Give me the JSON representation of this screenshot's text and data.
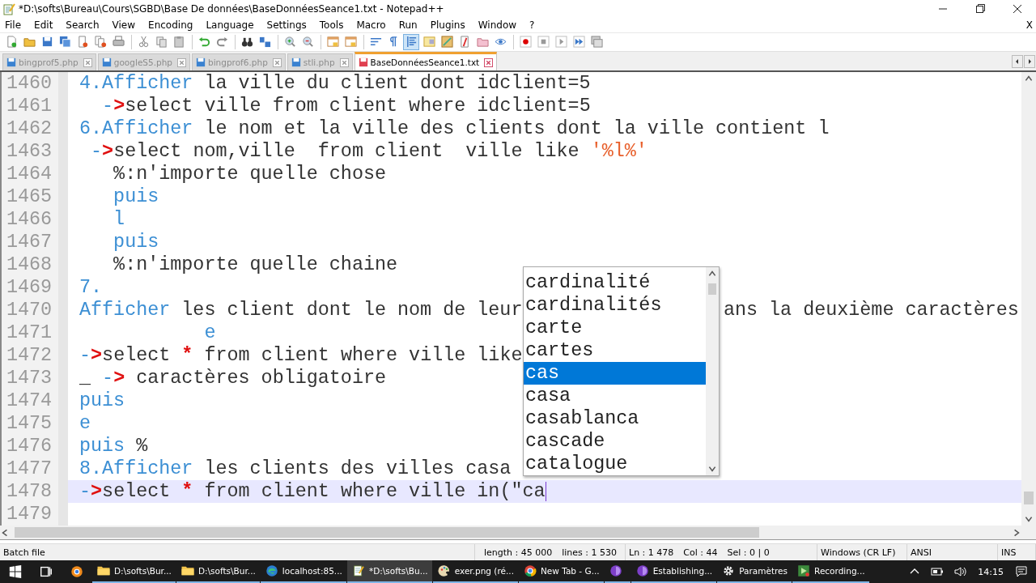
{
  "window": {
    "title": "*D:\\softs\\Bureau\\Cours\\SGBD\\Base De données\\BaseDonnéesSeance1.txt - Notepad++"
  },
  "menu": [
    "File",
    "Edit",
    "Search",
    "View",
    "Encoding",
    "Language",
    "Settings",
    "Tools",
    "Macro",
    "Run",
    "Plugins",
    "Window",
    "?"
  ],
  "close_document": "X",
  "toolbar": [
    {
      "kind": "new",
      "on": false
    },
    {
      "kind": "open",
      "on": false
    },
    {
      "kind": "save",
      "on": false
    },
    {
      "kind": "save-all",
      "on": false
    },
    {
      "kind": "close",
      "on": false
    },
    {
      "kind": "close-all",
      "on": false
    },
    {
      "kind": "print",
      "on": false
    },
    {
      "kind": "sep"
    },
    {
      "kind": "cut",
      "on": false
    },
    {
      "kind": "copy",
      "on": false
    },
    {
      "kind": "paste",
      "on": false
    },
    {
      "kind": "sep"
    },
    {
      "kind": "undo",
      "on": false
    },
    {
      "kind": "redo",
      "on": false
    },
    {
      "kind": "sep"
    },
    {
      "kind": "find",
      "on": false
    },
    {
      "kind": "replace",
      "on": false
    },
    {
      "kind": "sep"
    },
    {
      "kind": "zoom-in",
      "on": false
    },
    {
      "kind": "zoom-out",
      "on": false
    },
    {
      "kind": "sep"
    },
    {
      "kind": "window",
      "on": false
    },
    {
      "kind": "window",
      "on": false
    },
    {
      "kind": "sep"
    },
    {
      "kind": "wrap",
      "on": false
    },
    {
      "kind": "pilcrow",
      "on": false
    },
    {
      "kind": "indent",
      "on": true
    },
    {
      "kind": "panel",
      "on": false
    },
    {
      "kind": "map",
      "on": false
    },
    {
      "kind": "function",
      "on": false
    },
    {
      "kind": "folder",
      "on": false
    },
    {
      "kind": "eye",
      "on": false
    },
    {
      "kind": "sep"
    },
    {
      "kind": "record",
      "on": false
    },
    {
      "kind": "stop",
      "on": false
    },
    {
      "kind": "play",
      "on": false
    },
    {
      "kind": "play-multi",
      "on": false
    },
    {
      "kind": "save-macro",
      "on": false
    }
  ],
  "tabs": [
    {
      "label": "bingprof5.php",
      "modified": false,
      "selected": false
    },
    {
      "label": "googleS5.php",
      "modified": false,
      "selected": false
    },
    {
      "label": "bingprof6.php",
      "modified": false,
      "selected": false
    },
    {
      "label": "stli.php",
      "modified": false,
      "selected": false
    },
    {
      "label": "BaseDonnéesSeance1.txt",
      "modified": true,
      "selected": true
    }
  ],
  "editor": {
    "lines": [
      {
        "number": "1460",
        "current": false,
        "segments": [
          {
            "kind": "keyword",
            "text": "4.Afficher"
          },
          {
            "kind": "plain",
            "text": " la ville du client dont idclient=5"
          }
        ]
      },
      {
        "number": "1461",
        "current": false,
        "segments": [
          {
            "kind": "keyword",
            "text": "  -"
          },
          {
            "kind": "operator",
            "text": ">"
          },
          {
            "kind": "plain",
            "text": "select ville from client where idclient=5"
          }
        ]
      },
      {
        "number": "1462",
        "current": false,
        "segments": [
          {
            "kind": "keyword",
            "text": "6.Afficher"
          },
          {
            "kind": "plain",
            "text": " le nom et la ville des clients dont la ville contient l"
          }
        ]
      },
      {
        "number": "1463",
        "current": false,
        "segments": [
          {
            "kind": "keyword",
            "text": " -"
          },
          {
            "kind": "operator",
            "text": ">"
          },
          {
            "kind": "plain",
            "text": "select nom,ville  from client  ville like "
          },
          {
            "kind": "string",
            "text": "'%l%'"
          }
        ]
      },
      {
        "number": "1464",
        "current": false,
        "segments": [
          {
            "kind": "plain",
            "text": "   %:n'importe quelle chose"
          }
        ]
      },
      {
        "number": "1465",
        "current": false,
        "segments": [
          {
            "kind": "keyword",
            "text": "   puis"
          }
        ]
      },
      {
        "number": "1466",
        "current": false,
        "segments": [
          {
            "kind": "keyword",
            "text": "   l"
          }
        ]
      },
      {
        "number": "1467",
        "current": false,
        "segments": [
          {
            "kind": "keyword",
            "text": "   puis"
          }
        ]
      },
      {
        "number": "1468",
        "current": false,
        "segments": [
          {
            "kind": "plain",
            "text": "   %:n'importe quelle chaine"
          }
        ]
      },
      {
        "number": "1469",
        "current": false,
        "segments": [
          {
            "kind": "keyword",
            "text": "7."
          }
        ]
      },
      {
        "number": "1470",
        "current": false,
        "segments": [
          {
            "kind": "keyword",
            "text": "Afficher"
          },
          {
            "kind": "plain",
            "text": " les client dont le nom de leur"
          },
          {
            "kind": "after-popup",
            "text": "ans la deuxième caractères"
          }
        ]
      },
      {
        "number": "1471",
        "current": false,
        "segments": [
          {
            "kind": "keyword",
            "text": "           e"
          }
        ]
      },
      {
        "number": "1472",
        "current": false,
        "segments": [
          {
            "kind": "keyword",
            "text": "-"
          },
          {
            "kind": "operator",
            "text": ">"
          },
          {
            "kind": "plain",
            "text": "select "
          },
          {
            "kind": "operator",
            "text": "*"
          },
          {
            "kind": "plain",
            "text": " from client where ville like"
          }
        ]
      },
      {
        "number": "1473",
        "current": false,
        "segments": [
          {
            "kind": "plain",
            "text": "_ "
          },
          {
            "kind": "keyword",
            "text": "-"
          },
          {
            "kind": "operator",
            "text": ">"
          },
          {
            "kind": "plain",
            "text": " caractères obligatoire"
          }
        ]
      },
      {
        "number": "1474",
        "current": false,
        "segments": [
          {
            "kind": "keyword",
            "text": "puis"
          }
        ]
      },
      {
        "number": "1475",
        "current": false,
        "segments": [
          {
            "kind": "keyword",
            "text": "e"
          }
        ]
      },
      {
        "number": "1476",
        "current": false,
        "segments": [
          {
            "kind": "keyword",
            "text": "puis"
          },
          {
            "kind": "plain",
            "text": " %"
          }
        ]
      },
      {
        "number": "1477",
        "current": false,
        "segments": [
          {
            "kind": "keyword",
            "text": "8.Afficher"
          },
          {
            "kind": "plain",
            "text": " les clients des villes casa"
          }
        ]
      },
      {
        "number": "1478",
        "current": true,
        "segments": [
          {
            "kind": "keyword",
            "text": "-"
          },
          {
            "kind": "operator",
            "text": ">"
          },
          {
            "kind": "plain",
            "text": "select "
          },
          {
            "kind": "operator",
            "text": "*"
          },
          {
            "kind": "plain",
            "text": " from client where ville in(\"ca"
          }
        ]
      },
      {
        "number": "1479",
        "current": false
      }
    ],
    "autocomplete": [
      {
        "label": "cardinalité",
        "selected": false
      },
      {
        "label": "cardinalités",
        "selected": false
      },
      {
        "label": "carte",
        "selected": false
      },
      {
        "label": "cartes",
        "selected": false
      },
      {
        "label": "cas",
        "selected": true
      },
      {
        "label": "casa",
        "selected": false
      },
      {
        "label": "casablanca",
        "selected": false
      },
      {
        "label": "cascade",
        "selected": false
      },
      {
        "label": "catalogue",
        "selected": false
      }
    ]
  },
  "status_bar": [
    {
      "parts": [
        "Batch file"
      ]
    },
    {
      "parts": [
        "length : 45 000",
        "lines : 1 530"
      ]
    },
    {
      "parts": [
        "Ln : 1 478",
        "Col : 44",
        "Sel : 0 | 0"
      ]
    },
    {
      "parts": [
        "Windows (CR LF)"
      ]
    },
    {
      "parts": [
        "ANSI"
      ]
    },
    {
      "parts": [
        "INS"
      ]
    }
  ],
  "taskbar": {
    "apps": [
      {
        "kind": "folder",
        "label": "D:\\softs\\Bur...",
        "active": false
      },
      {
        "kind": "folder",
        "label": "D:\\softs\\Bur...",
        "active": false
      },
      {
        "kind": "edge",
        "label": "localhost:85...",
        "active": false
      },
      {
        "kind": "notepad",
        "label": "*D:\\softs\\Bu...",
        "active": true
      },
      {
        "kind": "paint",
        "label": "exer.png (ré...",
        "active": false
      },
      {
        "kind": "chrome",
        "label": "New Tab - G...",
        "active": false
      },
      {
        "kind": "disc",
        "active": false
      },
      {
        "kind": "disc",
        "label": "Establishing...",
        "active": false
      },
      {
        "kind": "gear",
        "label": "Paramètres",
        "active": false
      },
      {
        "kind": "recorder",
        "label": "Recording...",
        "active": false
      }
    ],
    "clock": "14:15"
  }
}
